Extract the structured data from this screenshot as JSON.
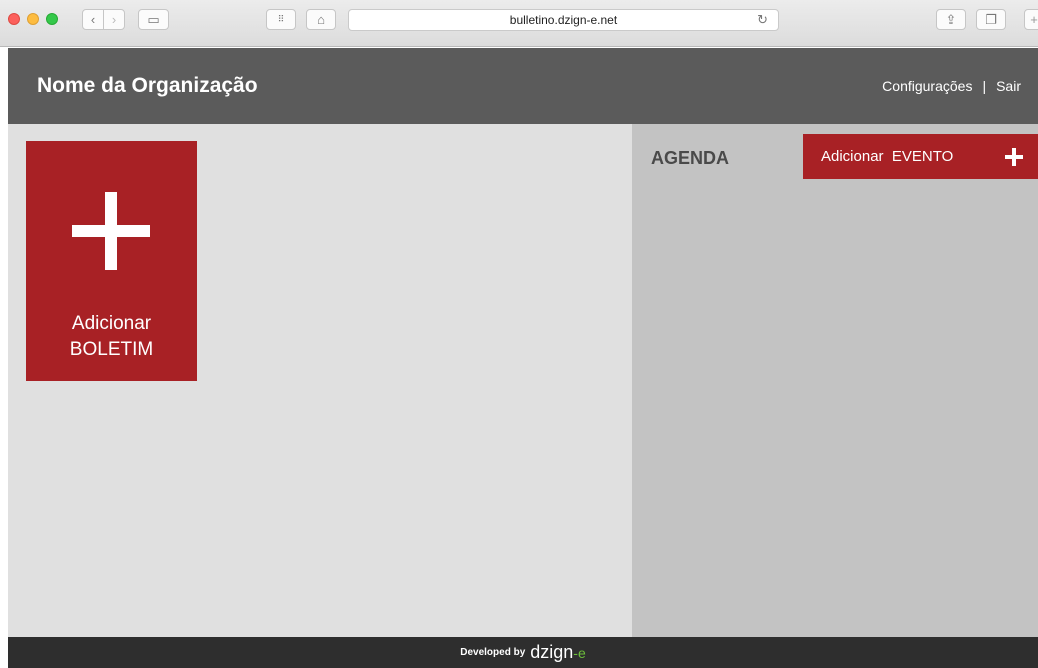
{
  "browser": {
    "url": "bulletino.dzign-e.net"
  },
  "header": {
    "org_name": "Nome da Organização",
    "settings_label": "Configurações",
    "separator": "|",
    "logout_label": "Sair"
  },
  "main": {
    "add_bulletin": {
      "line1": "Adicionar",
      "line2": "BOLETIM"
    },
    "agenda_title": "AGENDA",
    "add_event_label": "Adicionar  EVENTO"
  },
  "footer": {
    "developed_by": "Developed by",
    "brand": "dzign",
    "brand_suffix": "-e"
  },
  "colors": {
    "accent": "#a82125",
    "header_bg": "#5b5b5b",
    "footer_bg": "#2e2e2e"
  }
}
